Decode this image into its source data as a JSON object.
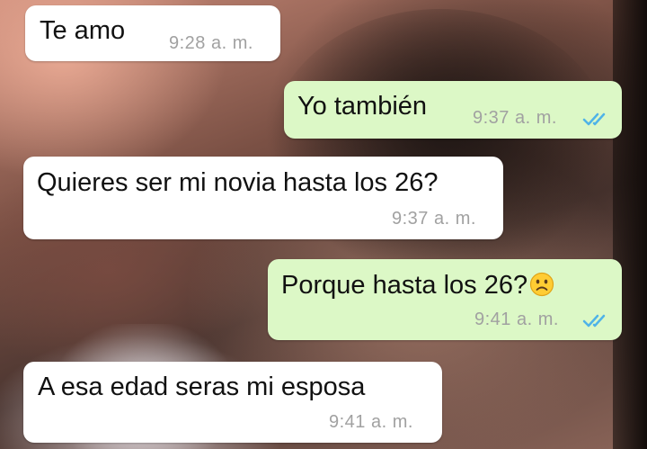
{
  "chat": {
    "messages": [
      {
        "direction": "incoming",
        "text": "Te amo",
        "time": "9:28 a. m."
      },
      {
        "direction": "outgoing",
        "text": "Yo también",
        "time": "9:37 a. m.",
        "status": "read-double-check-icon"
      },
      {
        "direction": "incoming",
        "text": "Quieres ser mi novia hasta los 26?",
        "time": "9:37 a. m."
      },
      {
        "direction": "outgoing",
        "text": "Porque hasta los 26?",
        "emoji": "sad-face-emoji-icon",
        "time": "9:41 a. m.",
        "status": "read-double-check-icon"
      },
      {
        "direction": "incoming",
        "text": "A esa edad seras mi esposa",
        "time": "9:41 a. m."
      }
    ]
  },
  "colors": {
    "incoming_bubble": "#ffffff",
    "outgoing_bubble": "#dcf8c6",
    "read_tick": "#4fb3e8",
    "timestamp": "#a1a1a1"
  }
}
